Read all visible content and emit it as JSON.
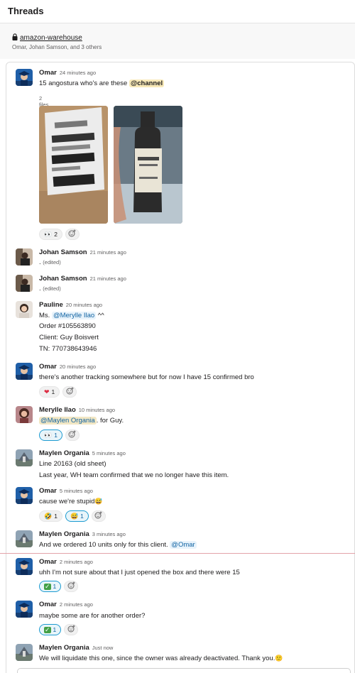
{
  "header": {
    "title": "Threads"
  },
  "channel": {
    "name": "amazon-warehouse",
    "members": "Omar, Johan Samson, and 3 others"
  },
  "messages": [
    {
      "author": "Omar",
      "time": "24 minutes ago",
      "text_pre": "15 angostura who's are these ",
      "mention": "@channel",
      "files_label": "2 files",
      "reactions": [
        {
          "emoji": "eyes",
          "glyph": "👀",
          "count": "2",
          "active": false
        }
      ]
    },
    {
      "author": "Johan Samson",
      "time": "21 minutes ago",
      "text": ".",
      "edited": "(edited)"
    },
    {
      "author": "Johan Samson",
      "time": "21 minutes ago",
      "text": ".",
      "edited": "(edited)"
    },
    {
      "author": "Pauline",
      "time": "20 minutes ago",
      "text_pre": "Ms. ",
      "mention": "@Merylle Ilao",
      "text_post": " ^^",
      "lines": [
        "Order #105563890",
        "Client: Guy Boisvert",
        "TN: 770738643946"
      ]
    },
    {
      "author": "Omar",
      "time": "20 minutes ago",
      "text": "there's another tracking somewhere but for now I have 15 confirmed bro",
      "reactions": [
        {
          "emoji": "heart",
          "glyph": "❤",
          "count": "1",
          "active": false
        }
      ]
    },
    {
      "author": "Merylle Ilao",
      "time": "10 minutes ago",
      "mention": "@Maylen Organia",
      "text_post": ". for Guy.",
      "reactions": [
        {
          "emoji": "eyes",
          "glyph": "👀",
          "count": "1",
          "active": true
        }
      ]
    },
    {
      "author": "Maylen Organia",
      "time": "5 minutes ago",
      "lines": [
        "Line 20163 (old sheet)",
        "Last year, WH team confirmed that we no longer have this item."
      ]
    },
    {
      "author": "Omar",
      "time": "5 minutes ago",
      "text": "cause we're stupid",
      "reactions": [
        {
          "emoji": "rolling-on-floor-laughing",
          "glyph": "🤣",
          "count": "1",
          "active": false
        },
        {
          "emoji": "grinning-sweat",
          "glyph": "😅",
          "count": "1",
          "active": true
        }
      ]
    },
    {
      "author": "Maylen Organia",
      "time": "3 minutes ago",
      "text_pre": "And we ordered 10 units only for this client. ",
      "mention": "@Omar"
    },
    {
      "author": "Omar",
      "time": "2 minutes ago",
      "text": "uhh I'm not sure about that I just opened the box and there were 15",
      "reactions": [
        {
          "emoji": "white-check-mark",
          "glyph": "✓",
          "count": "1",
          "active": true
        }
      ]
    },
    {
      "author": "Omar",
      "time": "2 minutes ago",
      "text": "maybe some are for another order?",
      "reactions": [
        {
          "emoji": "white-check-mark",
          "glyph": "✓",
          "count": "1",
          "active": true
        }
      ]
    },
    {
      "author": "Maylen Organia",
      "time": "Just now",
      "text": "We will liquidate this one, since the owner was already deactivated. Thank you."
    }
  ],
  "icons": {
    "lock": "lock-icon",
    "dropdown": "caret-down-icon",
    "add_reaction": "add-reaction-icon"
  },
  "colors": {
    "mention_bg": "#e8f3fb",
    "mention_text": "#1264a3",
    "active_reaction_border": "#1d9bd1",
    "new_divider": "#e3a3a9"
  }
}
